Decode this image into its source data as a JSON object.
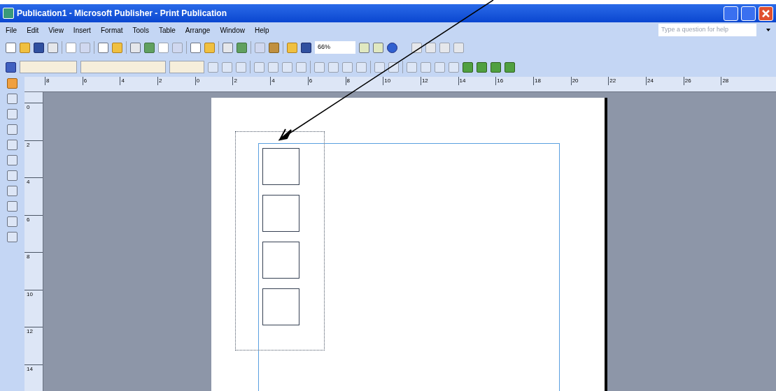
{
  "window": {
    "title": "Publication1 - Microsoft Publisher - Print Publication"
  },
  "menu": [
    "File",
    "Edit",
    "View",
    "Insert",
    "Format",
    "Tools",
    "Table",
    "Arrange",
    "Window",
    "Help"
  ],
  "help_box": {
    "placeholder": "Type a question for help"
  },
  "standard_toolbar": {
    "zoom": "66%"
  },
  "horizontal_ruler": [
    "8",
    "6",
    "4",
    "2",
    "0",
    "2",
    "4",
    "6",
    "8",
    "10",
    "12",
    "14",
    "16",
    "18",
    "20",
    "22",
    "24",
    "26",
    "28"
  ],
  "vertical_ruler": [
    "0",
    "2",
    "4",
    "6",
    "8",
    "10",
    "12",
    "14"
  ]
}
